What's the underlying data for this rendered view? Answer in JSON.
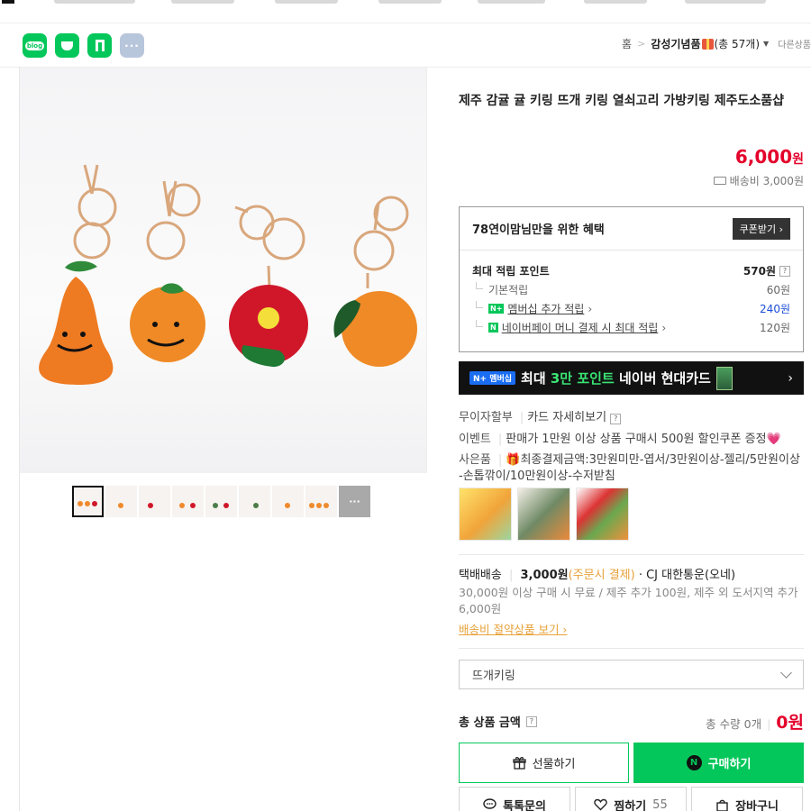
{
  "share": {
    "blog_label": "blog",
    "more_label": "···"
  },
  "breadcrumb": {
    "home": "홈",
    "category": "감성기념품",
    "count": "(총 57개)",
    "other": "다른상품"
  },
  "product": {
    "title": "제주 감귤 귤 키링 뜨개 키링 열쇠고리 가방키링 제주도소품샵",
    "price": "6,000",
    "currency": "원",
    "shipping_fee": "배송비 3,000원",
    "thumbnail_count": 9,
    "thumbnail_more": "···"
  },
  "benefit": {
    "title": "78연이맘님만을 위한 혜택",
    "coupon_button": "쿠폰받기 ›",
    "max_points_label": "최대 적립 포인트",
    "max_points_value": "570원",
    "rows": [
      {
        "label": "기본적립",
        "value": "60원"
      },
      {
        "label": "멤버십 추가 적립",
        "value": "240원",
        "badge": "N+",
        "arrow": "›"
      },
      {
        "label": "네이버페이 머니 결제 시 최대 적립",
        "value": "120원",
        "badge": "N",
        "arrow": "›"
      }
    ]
  },
  "banner": {
    "pill": "N+ 멤버십",
    "text_before": "최대 ",
    "text_highlight": "3만 포인트",
    "text_after": " 네이버 현대카드",
    "arrow": "›"
  },
  "details": {
    "installment_label": "무이자할부",
    "installment_value": "카드 자세히보기",
    "event_label": "이벤트",
    "event_value": "판매가 1만원 이상 상품 구매시 500원 할인쿠폰 증정💗",
    "gift_label": "사은품",
    "gift_value": "🎁최종결제금액:3만원미만-엽서/3만원이상-젤리/5만원이상",
    "gift_value_line2": "-손톱깎이/10만원이상-수저받침"
  },
  "delivery": {
    "method": "택배배송",
    "fee": "3,000원",
    "fee_note": "(주문시 결제)",
    "carrier": "· CJ 대한통운(오네)",
    "note": "30,000원 이상 구매 시 무료 / 제주 추가 100원, 제주 외 도서지역 추가 6,000원",
    "save_link": "배송비 절약상품 보기 ›"
  },
  "option": {
    "selected": "뜨개키링"
  },
  "total": {
    "label": "총 상품 금액",
    "qty": "총 수량 0개",
    "amount": "0원"
  },
  "actions": {
    "gift": "선물하기",
    "buy": "구매하기",
    "talk": "톡톡문의",
    "like": "찜하기",
    "like_count": "55",
    "cart": "장바구니"
  },
  "colors": {
    "accent": "#03c75a",
    "price": "#e4002b",
    "highlight": "#e8a13a"
  }
}
